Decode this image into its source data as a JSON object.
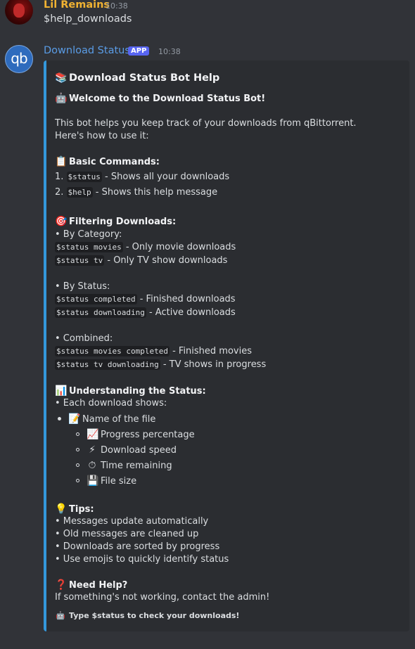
{
  "message1": {
    "username": "Lil Remains",
    "time": "10:38",
    "text": "$help_downloads"
  },
  "message2": {
    "username": "Download Status",
    "badge": "APP",
    "time": "10:38",
    "avatar_text": "qb"
  },
  "embed": {
    "accent_color": "#3498db",
    "title": "Download Status Bot Help",
    "welcome": "Welcome to the Download Status Bot!",
    "intro": "This bot helps you keep track of your downloads from qBittorrent. Here's how to use it:",
    "basic_header": "Basic Commands:",
    "basic": [
      {
        "num": "1.",
        "code": "$status",
        "desc": " - Shows all your downloads"
      },
      {
        "num": "2.",
        "code": "$help",
        "desc": " - Shows this help message"
      }
    ],
    "filter_header": "Filtering Downloads:",
    "by_category": "• By Category:",
    "category_cmds": [
      {
        "code": "$status movies",
        "desc": " - Only movie downloads"
      },
      {
        "code": "$status tv",
        "desc": " - Only TV show downloads"
      }
    ],
    "by_status": "• By Status:",
    "status_cmds": [
      {
        "code": "$status completed",
        "desc": " - Finished downloads"
      },
      {
        "code": "$status downloading",
        "desc": " - Active downloads"
      }
    ],
    "combined": "• Combined:",
    "combined_cmds": [
      {
        "code": "$status movies completed",
        "desc": " - Finished movies"
      },
      {
        "code": "$status tv downloading",
        "desc": " - TV shows in progress"
      }
    ],
    "understand_header": "Understanding the Status:",
    "each_shows": "• Each download shows:",
    "name_of_file": "Name of the file",
    "sub_items": [
      "Progress percentage",
      "Download speed",
      "Time remaining",
      "File size"
    ],
    "tips_header": "Tips:",
    "tips": [
      "• Messages update automatically",
      "• Old messages are cleaned up",
      "• Downloads are sorted by progress",
      "• Use emojis to quickly identify status"
    ],
    "help_header": "Need Help?",
    "help_text": "If something's not working, contact the admin!",
    "footer": "Type $status to check your downloads!"
  },
  "icons": {
    "title": "books-icon",
    "welcome": "robot-icon",
    "basic": "clipboard-icon",
    "filter": "target-icon",
    "understand": "bar-chart-icon",
    "name": "memo-icon",
    "progress": "chart-increasing-icon",
    "speed": "lightning-icon",
    "time": "stopwatch-icon",
    "size": "floppy-disk-icon",
    "tips": "lightbulb-icon",
    "help": "question-mark-icon",
    "footer": "robot-icon"
  }
}
